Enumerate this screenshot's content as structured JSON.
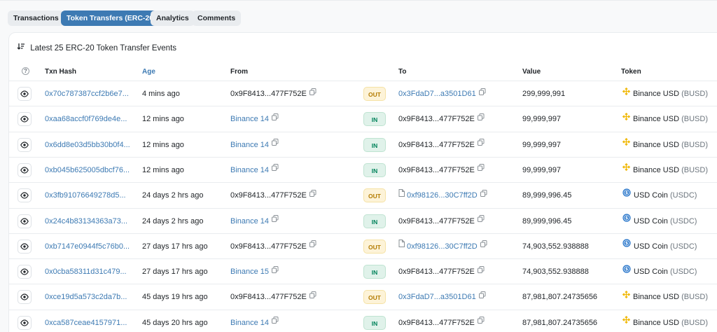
{
  "tabs": [
    {
      "label": "Transactions",
      "active": false
    },
    {
      "label": "Token Transfers (ERC-20)",
      "active": true
    },
    {
      "label": "Analytics",
      "active": false
    },
    {
      "label": "Comments",
      "active": false
    }
  ],
  "card": {
    "heading": "Latest 25 ERC-20 Token Transfer Events",
    "sort_icon": "sort-desc-icon"
  },
  "table": {
    "columns": {
      "help": "?",
      "txn_hash": "Txn Hash",
      "age": "Age",
      "from": "From",
      "to": "To",
      "value": "Value",
      "token": "Token"
    },
    "rows": [
      {
        "hash": "0x70c787387ccf2b6e7...",
        "age": "4 mins ago",
        "from": "0x9F8413...477F752E",
        "from_link": false,
        "dir": "OUT",
        "to": "0x3FdaD7...a3501D61",
        "to_link": true,
        "to_contract": false,
        "value": "299,999,991",
        "token": "Binance USD",
        "symbol": "(BUSD)",
        "token_icon": "binance-icon"
      },
      {
        "hash": "0xaa68accf0f769de4e...",
        "age": "12 mins ago",
        "from": "Binance 14",
        "from_link": true,
        "dir": "IN",
        "to": "0x9F8413...477F752E",
        "to_link": false,
        "to_contract": false,
        "value": "99,999,997",
        "token": "Binance USD",
        "symbol": "(BUSD)",
        "token_icon": "binance-icon"
      },
      {
        "hash": "0x6dd8e03d5bb30b0f4...",
        "age": "12 mins ago",
        "from": "Binance 14",
        "from_link": true,
        "dir": "IN",
        "to": "0x9F8413...477F752E",
        "to_link": false,
        "to_contract": false,
        "value": "99,999,997",
        "token": "Binance USD",
        "symbol": "(BUSD)",
        "token_icon": "binance-icon"
      },
      {
        "hash": "0xb045b625005dbcf76...",
        "age": "12 mins ago",
        "from": "Binance 14",
        "from_link": true,
        "dir": "IN",
        "to": "0x9F8413...477F752E",
        "to_link": false,
        "to_contract": false,
        "value": "99,999,997",
        "token": "Binance USD",
        "symbol": "(BUSD)",
        "token_icon": "binance-icon"
      },
      {
        "hash": "0x3fb91076649278d5...",
        "age": "24 days 2 hrs ago",
        "from": "0x9F8413...477F752E",
        "from_link": false,
        "dir": "OUT",
        "to": "0xf98126...30C7ff2D",
        "to_link": true,
        "to_contract": true,
        "value": "89,999,996.45",
        "token": "USD Coin",
        "symbol": "(USDC)",
        "token_icon": "usdc-icon"
      },
      {
        "hash": "0x24c4b83134363a73...",
        "age": "24 days 2 hrs ago",
        "from": "Binance 14",
        "from_link": true,
        "dir": "IN",
        "to": "0x9F8413...477F752E",
        "to_link": false,
        "to_contract": false,
        "value": "89,999,996.45",
        "token": "USD Coin",
        "symbol": "(USDC)",
        "token_icon": "usdc-icon"
      },
      {
        "hash": "0xb7147e0944f5c76b0...",
        "age": "27 days 17 hrs ago",
        "from": "0x9F8413...477F752E",
        "from_link": false,
        "dir": "OUT",
        "to": "0xf98126...30C7ff2D",
        "to_link": true,
        "to_contract": true,
        "value": "74,903,552.938888",
        "token": "USD Coin",
        "symbol": "(USDC)",
        "token_icon": "usdc-icon"
      },
      {
        "hash": "0x0cba58311d31c479...",
        "age": "27 days 17 hrs ago",
        "from": "Binance 15",
        "from_link": true,
        "dir": "IN",
        "to": "0x9F8413...477F752E",
        "to_link": false,
        "to_contract": false,
        "value": "74,903,552.938888",
        "token": "USD Coin",
        "symbol": "(USDC)",
        "token_icon": "usdc-icon"
      },
      {
        "hash": "0xce19d5a573c2da7b...",
        "age": "45 days 19 hrs ago",
        "from": "0x9F8413...477F752E",
        "from_link": false,
        "dir": "OUT",
        "to": "0x3FdaD7...a3501D61",
        "to_link": true,
        "to_contract": false,
        "value": "87,981,807.24735656",
        "token": "Binance USD",
        "symbol": "(BUSD)",
        "token_icon": "binance-icon"
      },
      {
        "hash": "0xca587ceae4157971...",
        "age": "45 days 20 hrs ago",
        "from": "Binance 14",
        "from_link": true,
        "dir": "IN",
        "to": "0x9F8413...477F752E",
        "to_link": false,
        "to_contract": false,
        "value": "87,981,807.24735656",
        "token": "Binance USD",
        "symbol": "(BUSD)",
        "token_icon": "binance-icon"
      }
    ]
  },
  "colors": {
    "accent": "#3d7ab3",
    "out_badge": "#fdf3d8",
    "in_badge": "#e0f2ea",
    "binance": "#f0b90b",
    "usdc": "#2775ca"
  }
}
